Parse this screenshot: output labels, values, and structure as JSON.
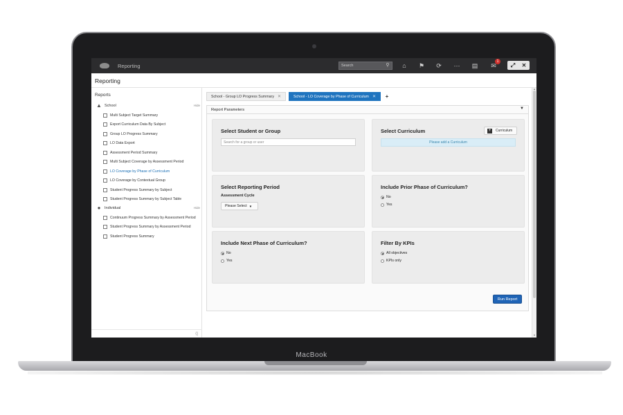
{
  "device": {
    "brand": "MacBook"
  },
  "topbar": {
    "app_name": "Reporting",
    "search_placeholder": "Search",
    "notification_count": "1"
  },
  "page_title": "Reporting",
  "sidebar": {
    "heading": "Reports",
    "groups": [
      {
        "label": "School",
        "hide": "Hide",
        "icon": "school-icon",
        "items": [
          "Multi Subject Target Summary",
          "Export Curriculum Data By Subject",
          "Group LO Progress Summary",
          "LO Data Export",
          "Assessment Period Summary",
          "Multi Subject Coverage by Assessment Period",
          "LO Coverage by Phase of Curriculum",
          "LO Coverage by Contextual Group",
          "Student Progress Summary by Subject",
          "Student Progress Summary by Subject Table"
        ],
        "active_index": 6
      },
      {
        "label": "Individual",
        "hide": "Hide",
        "icon": "person-icon",
        "items": [
          "Continuum Progress Summary by Assessment Period",
          "Student Progress Summary by Assessment Period",
          "Student Progress Summary"
        ]
      }
    ]
  },
  "tabs": [
    {
      "label": "School - Group LO Progress Summary",
      "active": false
    },
    {
      "label": "School - LO Coverage by Phase of Curriculum",
      "active": true
    }
  ],
  "tab_add": "+",
  "params": {
    "header": "Report Parameters",
    "select_student": {
      "title": "Select Student or Group",
      "placeholder": "Search for a group or user"
    },
    "select_curriculum": {
      "title": "Select Curriculum",
      "button": "Curriculum",
      "info": "Please add a Curriculum"
    },
    "reporting_period": {
      "title": "Select Reporting Period",
      "subtitle": "Assessment Cycle",
      "select": "Please Select"
    },
    "prior_phase": {
      "title": "Include Prior Phase of Curriculum?",
      "options": [
        "No",
        "Yes"
      ],
      "selected": "No"
    },
    "next_phase": {
      "title": "Include Next Phase of Curriculum?",
      "options": [
        "No",
        "Yes"
      ],
      "selected": "No"
    },
    "kpis": {
      "title": "Filter By KPIs",
      "options": [
        "All objectives",
        "KPIs only"
      ],
      "selected": "All objectives"
    },
    "run_button": "Run Report"
  }
}
